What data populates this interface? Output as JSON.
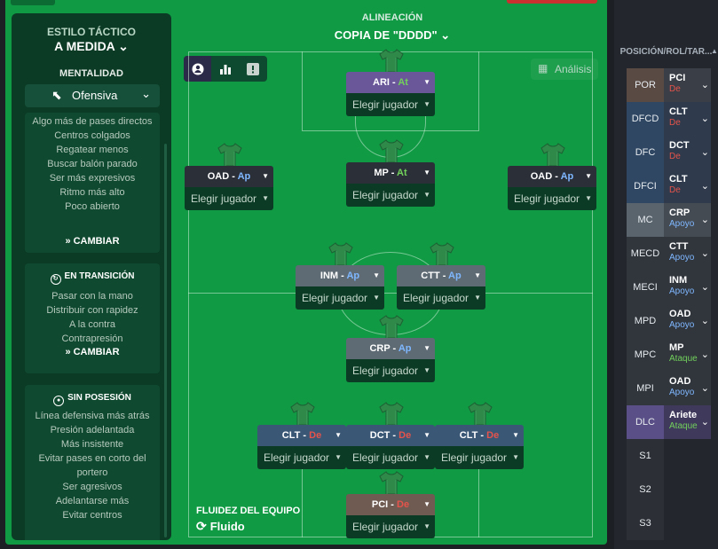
{
  "colors": {
    "panel": "#0f9a43",
    "dark": "#0b3b25",
    "role_purple": "#6a579a",
    "role_dark": "#2a2f38",
    "role_grey": "#5e6b74",
    "role_brown": "#6f5b52",
    "role_blue": "#3a5776",
    "de": "#e5534b",
    "ap": "#7fb7ff",
    "at": "#72d15b",
    "apoyo": "#7fb7ff",
    "ataque": "#72d15b"
  },
  "left": {
    "estilo_label": "ESTILO TÁCTICO",
    "estilo_value": "A MEDIDA",
    "mentalidad_label": "MENTALIDAD",
    "mentalidad_value": "Ofensiva",
    "box1_items": [
      "Algo más de pases directos",
      "Centros colgados",
      "Regatear menos",
      "Buscar balón parado",
      "Ser más expresivos",
      "Ritmo más alto",
      "Poco abierto"
    ],
    "cambiar": "CAMBIAR",
    "box2_title": "EN TRANSICIÓN",
    "box2_items": [
      "Pasar con la mano",
      "Distribuir con rapidez",
      "A la contra",
      "Contrapresión"
    ],
    "box3_title": "SIN POSESIÓN",
    "box3_items": [
      "Línea defensiva más atrás",
      "Presión adelantada",
      "Más insistente",
      "Evitar pases en corto del portero",
      "Ser agresivos",
      "Adelantarse más",
      "Evitar centros"
    ]
  },
  "header": {
    "alineacion_label": "ALINEACIÓN",
    "alineacion_value": "COPIA DE \"DDDD\""
  },
  "toolbar": {
    "analisis": "Análisis",
    "icons": [
      "player-icon",
      "bars-icon",
      "alert-icon",
      "grid-icon"
    ]
  },
  "fluidez": {
    "label": "FLUIDEZ DEL EQUIPO",
    "value": "Fluido"
  },
  "select_placeholder": "Elegir jugador",
  "players": [
    {
      "pos": "ARI",
      "duty": "At",
      "duty_color": "at",
      "bg": "role_purple"
    },
    {
      "pos": "OAD",
      "duty": "Ap",
      "duty_color": "ap",
      "bg": "role_dark"
    },
    {
      "pos": "MP",
      "duty": "At",
      "duty_color": "at",
      "bg": "role_dark"
    },
    {
      "pos": "OAD",
      "duty": "Ap",
      "duty_color": "ap",
      "bg": "role_dark"
    },
    {
      "pos": "INM",
      "duty": "Ap",
      "duty_color": "ap",
      "bg": "role_grey"
    },
    {
      "pos": "CTT",
      "duty": "Ap",
      "duty_color": "ap",
      "bg": "role_grey"
    },
    {
      "pos": "CRP",
      "duty": "Ap",
      "duty_color": "ap",
      "bg": "role_grey"
    },
    {
      "pos": "CLT",
      "duty": "De",
      "duty_color": "de",
      "bg": "role_blue"
    },
    {
      "pos": "DCT",
      "duty": "De",
      "duty_color": "de",
      "bg": "role_blue"
    },
    {
      "pos": "CLT",
      "duty": "De",
      "duty_color": "de",
      "bg": "role_blue"
    },
    {
      "pos": "PCI",
      "duty": "De",
      "duty_color": "de",
      "bg": "role_brown"
    }
  ],
  "roles_panel": {
    "header": "POSICIÓN/ROL/TAR...",
    "rows": [
      {
        "pos": "POR",
        "role": "PCI",
        "duty": "De",
        "tone": "brown"
      },
      {
        "pos": "DFCD",
        "role": "CLT",
        "duty": "De",
        "tone": "blue"
      },
      {
        "pos": "DFC",
        "role": "DCT",
        "duty": "De",
        "tone": "blue"
      },
      {
        "pos": "DFCI",
        "role": "CLT",
        "duty": "De",
        "tone": "blue"
      },
      {
        "pos": "MC",
        "role": "CRP",
        "duty": "Apoyo",
        "tone": "grey"
      },
      {
        "pos": "MECD",
        "role": "CTT",
        "duty": "Apoyo",
        "tone": "dark"
      },
      {
        "pos": "MECI",
        "role": "INM",
        "duty": "Apoyo",
        "tone": "dark"
      },
      {
        "pos": "MPD",
        "role": "OAD",
        "duty": "Apoyo",
        "tone": "dark"
      },
      {
        "pos": "MPC",
        "role": "MP",
        "duty": "Ataque",
        "tone": "dark"
      },
      {
        "pos": "MPI",
        "role": "OAD",
        "duty": "Apoyo",
        "tone": "dark"
      },
      {
        "pos": "DLC",
        "role": "Ariete",
        "duty": "Ataque",
        "tone": "purple"
      },
      {
        "pos": "S1",
        "role": "",
        "duty": "",
        "tone": "sub"
      },
      {
        "pos": "S2",
        "role": "",
        "duty": "",
        "tone": "sub"
      },
      {
        "pos": "S3",
        "role": "",
        "duty": "",
        "tone": "sub"
      }
    ]
  }
}
